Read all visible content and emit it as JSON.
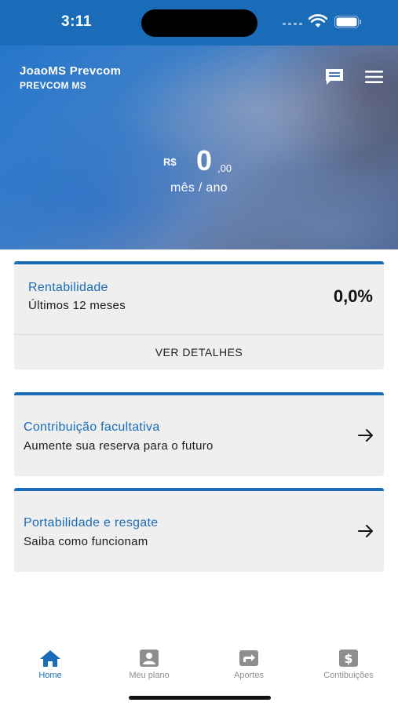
{
  "status_bar": {
    "time": "3:11"
  },
  "header": {
    "user_name": "JoaoMS Prevcom",
    "org_name": "PREVCOM MS",
    "chat_icon": "chat-icon",
    "menu_icon": "hamburger-menu-icon"
  },
  "balance": {
    "currency": "R$",
    "integer": "0",
    "decimal": ",00",
    "period": "mês / ano"
  },
  "cards": {
    "rentabilidade": {
      "title": "Rentabilidade",
      "subtitle": "Últimos 12 meses",
      "value": "0,0%",
      "action": "VER DETALHES"
    },
    "contribuicao": {
      "title": "Contribuição facultativa",
      "subtitle": "Aumente sua reserva para o futuro"
    },
    "portabilidade": {
      "title": "Portabilidade e resgate",
      "subtitle": "Saiba como funcionam"
    }
  },
  "tabs": [
    {
      "label": "Home",
      "icon": "home-icon",
      "active": true
    },
    {
      "label": "Meu plano",
      "icon": "person-card-icon",
      "active": false
    },
    {
      "label": "Aportes",
      "icon": "forward-arrow-icon",
      "active": false
    },
    {
      "label": "Contibuições",
      "icon": "dollar-icon",
      "active": false
    }
  ],
  "colors": {
    "primary": "#1a6cb8",
    "card_background": "#efefef",
    "tab_inactive": "#8e8e8e"
  }
}
